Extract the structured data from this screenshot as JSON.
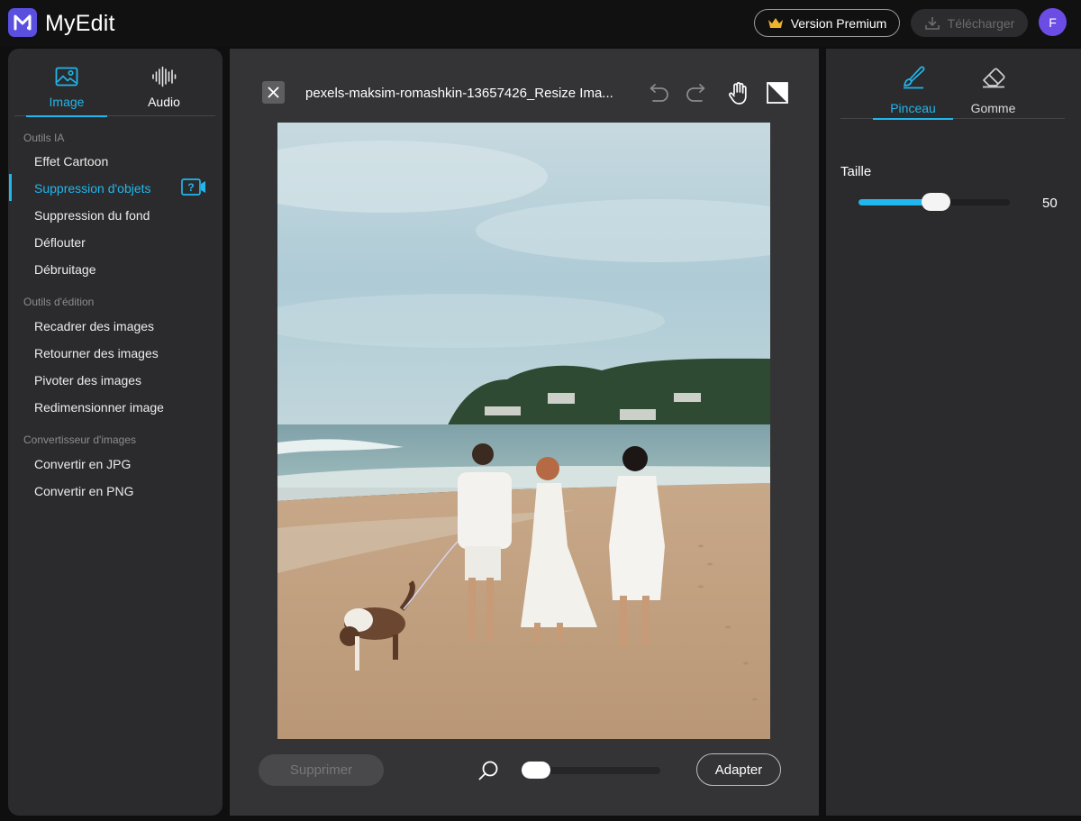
{
  "app": {
    "title": "MyEdit",
    "premium_label": "Version Premium",
    "download_label": "Télécharger",
    "avatar_initial": "F"
  },
  "sidebar": {
    "tabs": [
      {
        "label": "Image",
        "icon": "image-icon",
        "active": true
      },
      {
        "label": "Audio",
        "icon": "audio-wave-icon",
        "active": false
      }
    ],
    "sections": [
      {
        "title": "Outils IA",
        "items": [
          {
            "label": "Effet Cartoon"
          },
          {
            "label": "Suppression d'objets",
            "active": true
          },
          {
            "label": "Suppression du fond"
          },
          {
            "label": "Déflouter"
          },
          {
            "label": "Débruitage"
          }
        ]
      },
      {
        "title": "Outils d'édition",
        "items": [
          {
            "label": "Recadrer des images"
          },
          {
            "label": "Retourner des images"
          },
          {
            "label": "Pivoter des images"
          },
          {
            "label": "Redimensionner image"
          }
        ]
      },
      {
        "title": "Convertisseur d'images",
        "items": [
          {
            "label": "Convertir en JPG"
          },
          {
            "label": "Convertir en PNG"
          }
        ]
      }
    ]
  },
  "editor": {
    "file_name": "pexels-maksim-romashkin-13657426_Resize Ima...",
    "toolbar_icons": [
      "undo-icon",
      "redo-icon",
      "hand-pan-icon",
      "compare-icon"
    ],
    "delete_label": "Supprimer",
    "fit_label": "Adapter",
    "zoom_level": 0.0
  },
  "right_panel": {
    "tabs": [
      {
        "label": "Pinceau",
        "icon": "brush-icon",
        "active": true
      },
      {
        "label": "Gomme",
        "icon": "eraser-icon",
        "active": false
      }
    ],
    "size_label": "Taille",
    "size_value": "50",
    "size_fraction": 0.5
  },
  "colors": {
    "accent": "#22b6ec",
    "logo": "#5b4fe0",
    "avatar": "#6b4de6"
  }
}
